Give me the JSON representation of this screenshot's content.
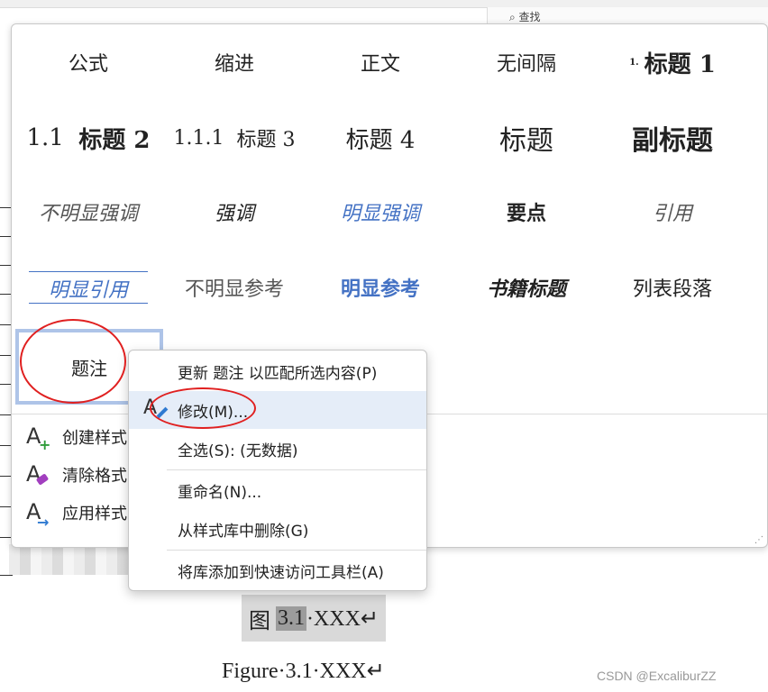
{
  "document": {
    "toolbar_search": "查找",
    "caption_prefix": "图",
    "caption_number": "3.1",
    "caption_text": "·XXX↵",
    "figure_caption": "Figure·3.1·XXX↵",
    "watermark": "CSDN @ExcaliburZZ"
  },
  "gallery": {
    "row1": [
      "公式",
      "缩进",
      "正文",
      "无间隔",
      "标题 1"
    ],
    "heading1_marker": "1.",
    "row2": {
      "heading2_number": "1.1",
      "heading2": "标题 2",
      "heading3_number": "1.1.1",
      "heading3": "标题 3",
      "heading4": "标题 4",
      "title": "标题",
      "subtitle": "副标题"
    },
    "row3": [
      "不明显强调",
      "强调",
      "明显强调",
      "要点",
      "引用"
    ],
    "row4": [
      "明显引用",
      "不明显参考",
      "明显参考",
      "书籍标题",
      "列表段落"
    ],
    "caption_style": "题注",
    "actions": [
      "创建样式",
      "清除格式",
      "应用样式"
    ]
  },
  "context_menu": {
    "items": [
      "更新 题注 以匹配所选内容(P)",
      "修改(M)...",
      "全选(S): (无数据)",
      "重命名(N)...",
      "从样式库中删除(G)",
      "将库添加到快速访问工具栏(A)"
    ],
    "highlighted_index": 1
  },
  "colors": {
    "accent_blue": "#4472c4",
    "annotation_red": "#e02020",
    "hover_bg": "#e5edf8"
  }
}
